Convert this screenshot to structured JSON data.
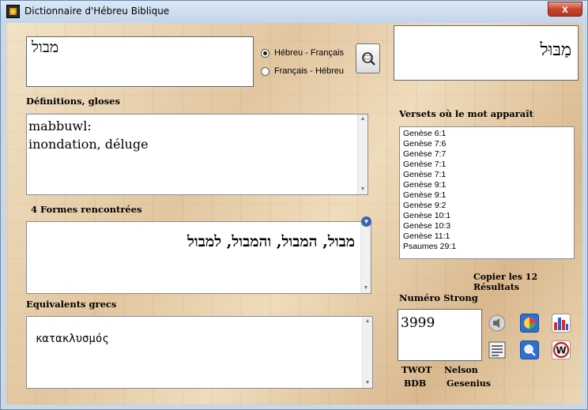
{
  "window": {
    "title": "Dictionnaire d'Hébreu Biblique",
    "close_glyph": "x"
  },
  "search": {
    "input_value": "מבול",
    "radio_he_fr": "Hébreu - Français",
    "radio_fr_he": "Français - Hébreu",
    "selected_mode": "Hébreu - Français"
  },
  "pointed_word": "מַבּוּל",
  "definitions": {
    "label": "Définitions, gloses",
    "lines": [
      "mabbuwl:",
      "inondation, déluge"
    ]
  },
  "forms": {
    "label": "4 Formes rencontrées",
    "value": "מבול, המבול, והמבול, למבול"
  },
  "greek": {
    "label": "Equivalents grecs",
    "value": "κατακλυσμός"
  },
  "verses": {
    "label": "Versets où le mot apparaît",
    "items": [
      "Genèse 6:1",
      "Genèse 7:6",
      "Genèse 7:7",
      "Genèse 7:1",
      "Genèse 7:1",
      "Genèse 9:1",
      "Genèse 9:1",
      "Genèse 9:2",
      "Genèse 10:1",
      "Genèse 10:3",
      "Genèse 11:1",
      "Psaumes 29:1"
    ],
    "copy_label": "Copier les 12 Résultats"
  },
  "strong": {
    "label": "Numéro Strong",
    "value": "3999",
    "links": {
      "twot": "TWOT",
      "nelson": "Nelson",
      "bdb": "BDB",
      "gesenius": "Gesenius"
    }
  },
  "icons": {
    "search": "magnifier-icon",
    "speaker": "speaker-icon",
    "pie": "pie-chart-icon",
    "bar": "bar-chart-icon",
    "notes": "notepad-icon",
    "zoom": "zoom-icon",
    "w": "w-logo-icon"
  },
  "colors": {
    "parchment": "#ead7b7",
    "title_bar": "#c9d8e8",
    "close_red": "#c7432c"
  }
}
